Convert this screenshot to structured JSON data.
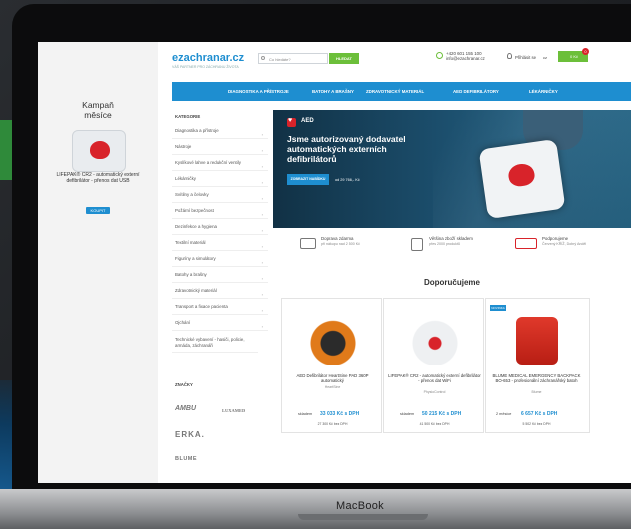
{
  "device_label": "MacBook",
  "ad": {
    "title_line1": "Kampaň",
    "title_line2": "měsíce",
    "product_text": "LIFEPAK® CR2 - automatický externí defibrilátor - přenos dat USB",
    "button": "KOUPIT"
  },
  "header": {
    "logo": "ezachranar.cz",
    "logo_sub": "VÁŠ PARTNER PRO ZÁCHRANU ŽIVOTA",
    "search_placeholder": "Co hledáte?",
    "search_button": "HLEDAT",
    "phone": "+420 601 155 100",
    "email": "info@ezachranar.cz",
    "login": "Přihlásit se",
    "lang": "cz",
    "cart": "0 Kč",
    "cart_count": "0"
  },
  "nav": [
    "DIAGNOSTIKA A PŘÍSTROJE",
    "BATOHY A BRAŠNY",
    "ZDRAVOTNICKÝ MATERIÁL",
    "AED DEFIBRILÁTORY",
    "LÉKÁRNIČKY"
  ],
  "categories": {
    "title": "KATEGORIE",
    "items": [
      "Diagnostika a přístroje",
      "Nástroje",
      "Kyslíkové lahve a redukční ventily",
      "Lékárničky",
      "Svítilny a čelovky",
      "Požární bezpečnost",
      "Dezinfekce a hygiena",
      "Textilní materiál",
      "Figuríny a simulátory",
      "Batohy a brašny",
      "Zdravotnický materiál",
      "Transport a fixace pacienta",
      "Ojchání",
      "Technické vybavení - hasiči, policie, armáda, záchranáři"
    ],
    "brands_title": "ZNAČKY",
    "brands": [
      "AMBU",
      "LUXAMED",
      "ERKA.",
      "BLUME"
    ]
  },
  "hero": {
    "tag": "AED",
    "title": "Jsme autorizovaný dodavatel automatických externích defibrilátorů",
    "button": "ZOBRAZIT NABÍDKU",
    "price": "od 29 766,- Kč"
  },
  "features": [
    {
      "title": "Doprava zdarma",
      "sub": "při nákupu nad 2 500 Kč"
    },
    {
      "title": "Většina zboží skladem",
      "sub": "přes 2000 produktů"
    },
    {
      "title": "Podporujeme",
      "sub": "Červený KŘÍŽ, Dobrý Anděl"
    }
  ],
  "section_title": "Doporučujeme",
  "products": [
    {
      "name": "AED Defibrilátor HeartSine PAD 360P automatický",
      "brand": "HeartSine",
      "stock": "skladem",
      "price": "33 033 Kč s DPH",
      "net": "27 300 Kč bez DPH"
    },
    {
      "name": "LIFEPAK® CR2 - automatický externí defibrilátor - přenos dat WiFi",
      "brand": "PhysioControl",
      "stock": "skladem",
      "price": "50 215 Kč s DPH",
      "net": "41 500 Kč bez DPH"
    },
    {
      "badge": "NOVINKA",
      "name": "BLUME MEDICAL EMERGENCY BACKPACK BO-653 - profesionální záchranářský batoh",
      "brand": "Blume",
      "stock": "2 měsíce",
      "price": "6 657 Kč s DPH",
      "net": "5 502 Kč bez DPH"
    }
  ]
}
